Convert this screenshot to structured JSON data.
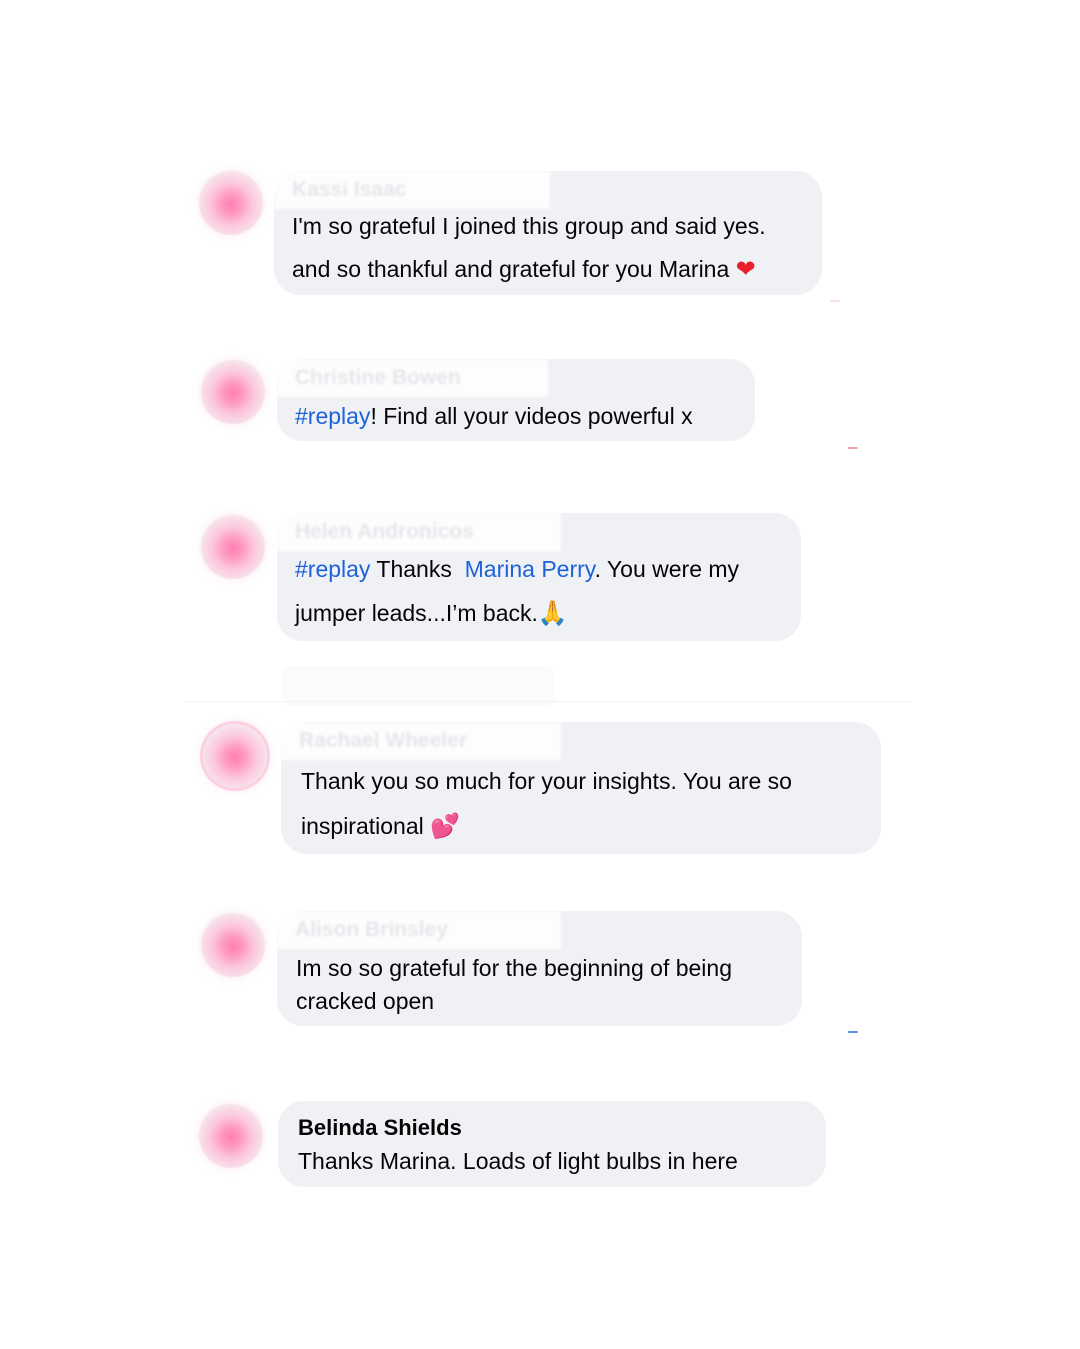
{
  "comments": [
    {
      "author": "Kassi Isaac",
      "line1": "I'm so grateful I joined this group and said yes.",
      "line2": "and so thankful and grateful for you Marina",
      "emoji": "❤"
    },
    {
      "author": "Christine Bowen",
      "hashtag": "#replay",
      "line1_rest": "! Find all your videos powerful x"
    },
    {
      "author": "Helen Andronicos",
      "hashtag": "#replay",
      "line1_mid": " Thanks  ",
      "mention": "Marina Perry",
      "line1_end": ". You were my",
      "line2": "jumper leads...I’m back.",
      "emoji": "🙏"
    },
    {
      "author": "Rachael Wheeler",
      "line1": "Thank you so much for your insights. You are so",
      "line2": "inspirational ",
      "emoji": "💕"
    },
    {
      "author": "Alison Brinsley",
      "line1": "Im so so grateful for the beginning of being",
      "line2": "cracked open"
    },
    {
      "author": "Belinda Shields",
      "line1": "Thanks Marina. Loads of light bulbs in here"
    }
  ],
  "colors": {
    "bubble": "#eff1f5",
    "link": "#1d62d8",
    "text": "#050505",
    "avatar_pink": "#ff7fb1"
  }
}
